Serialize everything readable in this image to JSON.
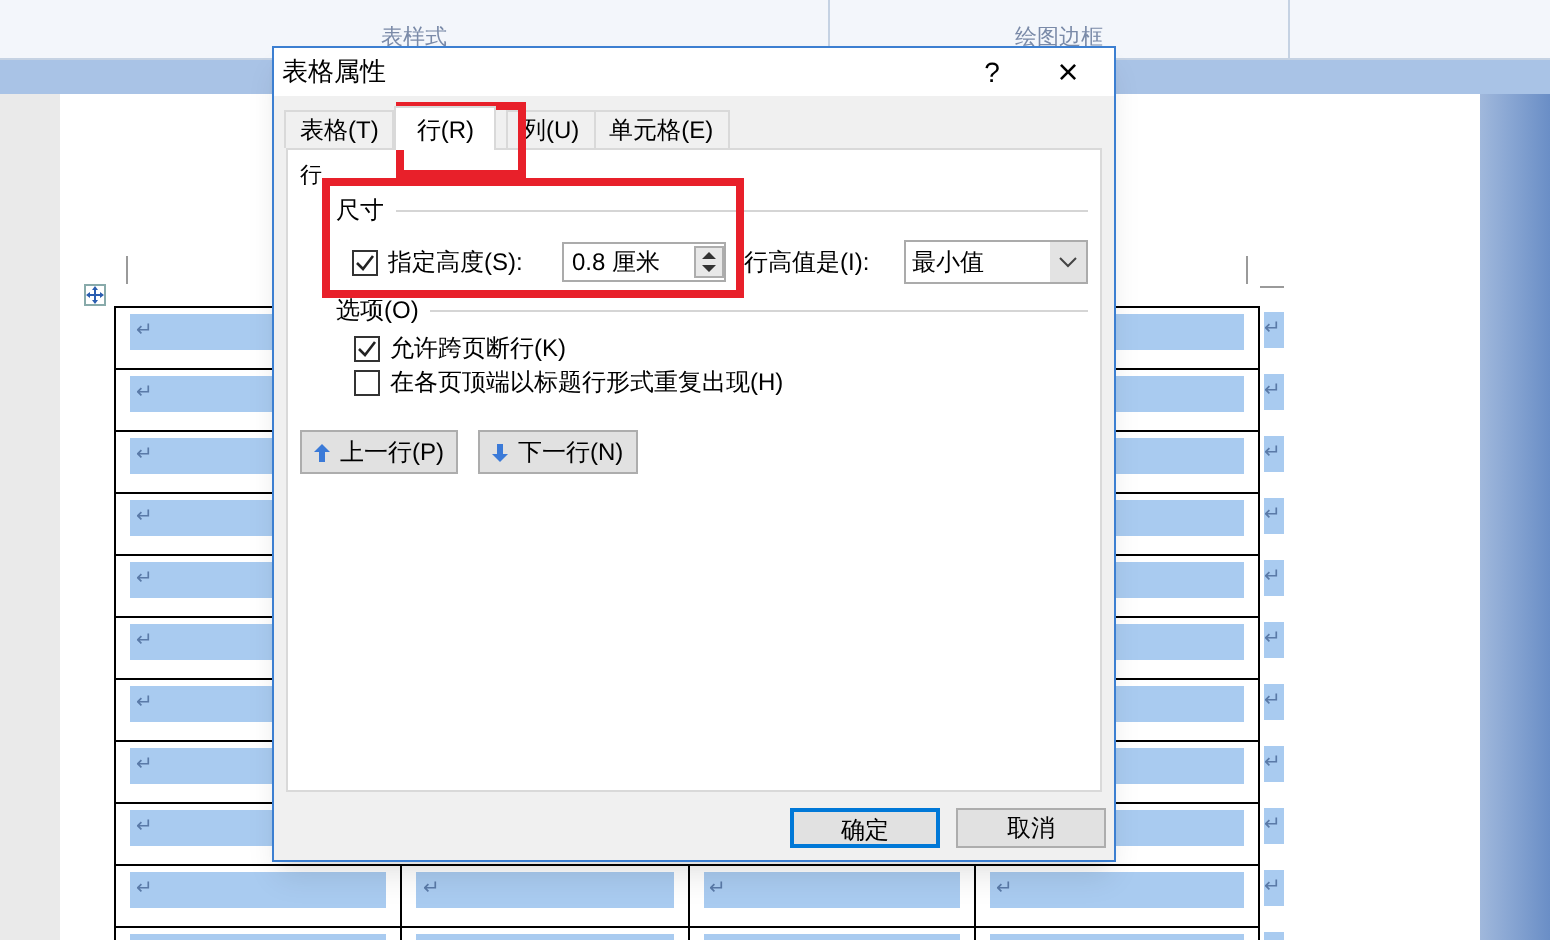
{
  "ribbon": {
    "groups": [
      {
        "label": "表样式"
      },
      {
        "label": "绘图边框"
      }
    ]
  },
  "dialog": {
    "title": "表格属性",
    "help": "?",
    "close": "×",
    "tabs": [
      {
        "label": "表格(T)",
        "selected": false
      },
      {
        "label": "行(R)",
        "selected": true
      },
      {
        "label": "列(U)",
        "selected": false
      },
      {
        "label": "单元格(E)",
        "selected": false
      }
    ],
    "group_label": "行",
    "size": {
      "heading": "尺寸",
      "specify_height": {
        "label": "指定高度(S):",
        "checked": true
      },
      "height_value": "0.8 厘米",
      "height_rule_label": "行高值是(I):",
      "height_rule_value": "最小值"
    },
    "options": {
      "heading": "选项(O)",
      "items": [
        {
          "label": "允许跨页断行(K)",
          "checked": true
        },
        {
          "label": "在各页顶端以标题行形式重复出现(H)",
          "checked": false
        }
      ]
    },
    "nav_buttons": [
      {
        "label": "上一行(P)",
        "kind": "up"
      },
      {
        "label": "下一行(N)",
        "kind": "down"
      }
    ],
    "buttons": [
      {
        "label": "确定",
        "default": true
      },
      {
        "label": "取消",
        "default": false
      }
    ]
  },
  "table": {
    "rows": [
      {
        "cells": [
          "↵"
        ],
        "end_mark": "↵"
      },
      {
        "cells": [
          "↵"
        ],
        "end_mark": "↵"
      },
      {
        "cells": [
          "↵"
        ],
        "end_mark": "↵"
      },
      {
        "cells": [
          "↵"
        ],
        "end_mark": "↵"
      },
      {
        "cells": [
          "↵"
        ],
        "end_mark": "↵"
      },
      {
        "cells": [
          "↵"
        ],
        "end_mark": "↵"
      },
      {
        "cells": [
          "↵"
        ],
        "end_mark": "↵"
      },
      {
        "cells": [
          "↵"
        ],
        "end_mark": "↵"
      },
      {
        "cells": [
          "↵"
        ],
        "end_mark": "↵"
      },
      {
        "cells": [
          "↵",
          "↵",
          "↵",
          "↵"
        ],
        "end_mark": "↵"
      }
    ]
  }
}
